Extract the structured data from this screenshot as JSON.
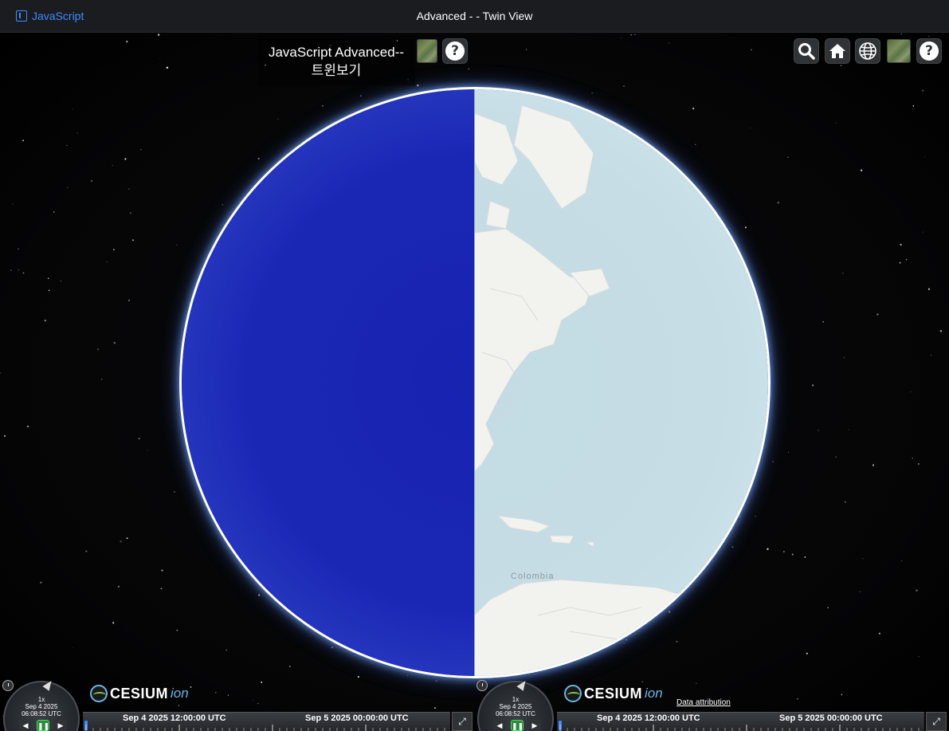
{
  "topbar": {
    "brand_label": "JavaScript",
    "title": "Advanced - - Twin View"
  },
  "overlay": {
    "title_line1": "JavaScript Advanced--",
    "title_line2": "트윈보기",
    "help_label": "?"
  },
  "toolbar": {
    "items": [
      "search-icon",
      "home-icon",
      "globe-icon",
      "layers-icon",
      "help-icon"
    ],
    "help_label": "?"
  },
  "map": {
    "label": "Colombia"
  },
  "left_view": {
    "animation": {
      "speed": "1x",
      "date": "Sep 4 2025",
      "time": "06:08:52 UTC"
    },
    "logo_text": "CESIUM",
    "logo_suffix": "ion",
    "timeline": {
      "label_1": "Sep 4 2025 12:00:00 UTC",
      "label_2": "Sep 5 2025 00:00:00 UTC"
    }
  },
  "right_view": {
    "animation": {
      "speed": "1x",
      "date": "Sep 4 2025",
      "time": "06:08:52 UTC"
    },
    "logo_text": "CESIUM",
    "logo_suffix": "ion",
    "data_attribution": "Data attribution",
    "timeline": {
      "label_1": "Sep 4 2025 12:00:00 UTC",
      "label_2": "Sep 5 2025 00:00:00 UTC"
    }
  },
  "colors": {
    "accent": "#3d8bff",
    "left_globe": "#1a27b5",
    "right_globe": "#c6dde6",
    "play_green": "#2c8a3c"
  }
}
